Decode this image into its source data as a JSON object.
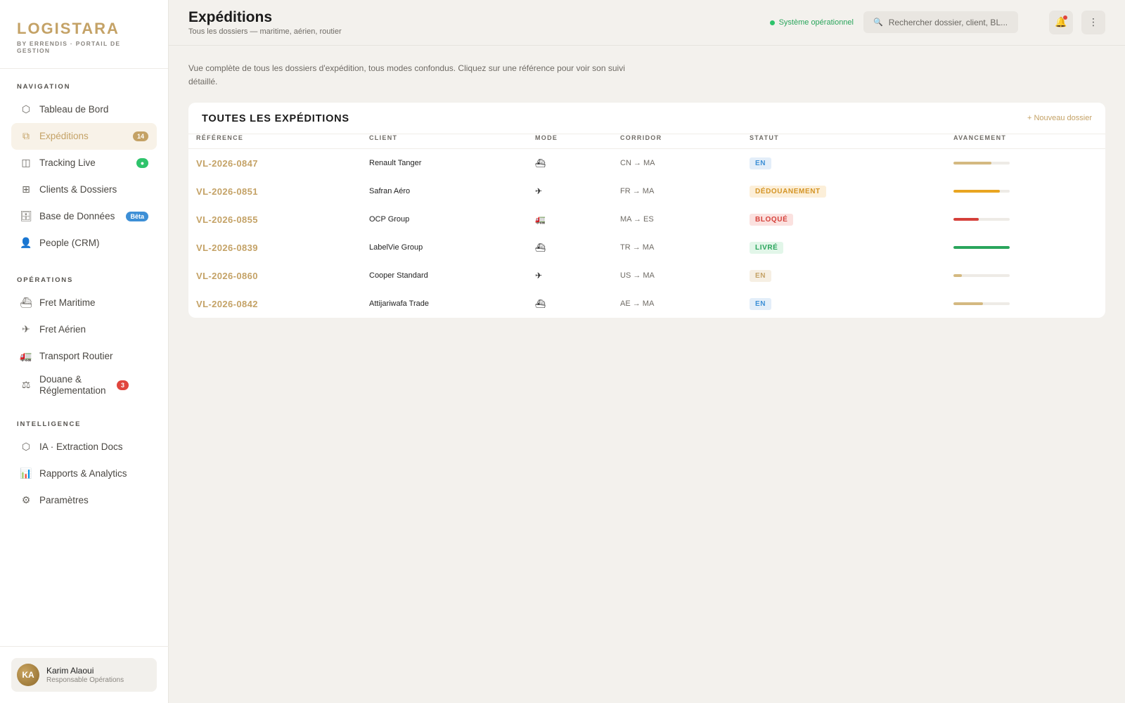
{
  "brand": {
    "name": "LOGISTARA",
    "subtitle": "BY ERRENDIS · PORTAIL DE GESTION"
  },
  "nav": {
    "sections": [
      {
        "title": "NAVIGATION",
        "items": [
          {
            "label": "Tableau de Bord",
            "icon": "hexagon-icon",
            "glyph": "⬡"
          },
          {
            "label": "Expéditions",
            "icon": "layers-icon",
            "glyph": "⧉",
            "badge": "14",
            "active": true
          },
          {
            "label": "Tracking Live",
            "icon": "map-icon",
            "glyph": "◫",
            "badge": "●"
          },
          {
            "label": "Clients & Dossiers",
            "icon": "grid-icon",
            "glyph": "⊞"
          },
          {
            "label": "Base de Données",
            "icon": "database-icon",
            "glyph": "🗄",
            "badge": "Bêta"
          },
          {
            "label": "People (CRM)",
            "icon": "person-icon",
            "glyph": "👤"
          }
        ]
      },
      {
        "title": "OPÉRATIONS",
        "items": [
          {
            "label": "Fret Maritime",
            "icon": "ship-icon",
            "glyph": "⛴"
          },
          {
            "label": "Fret Aérien",
            "icon": "plane-icon",
            "glyph": "✈"
          },
          {
            "label": "Transport Routier",
            "icon": "truck-icon",
            "glyph": "🚛"
          },
          {
            "label": "Douane & Réglementation",
            "icon": "scales-icon",
            "glyph": "⚖",
            "badge": "3"
          }
        ]
      },
      {
        "title": "INTELLIGENCE",
        "items": [
          {
            "label": "IA · Extraction Docs",
            "icon": "hexagon-icon",
            "glyph": "⬡"
          },
          {
            "label": "Rapports & Analytics",
            "icon": "bar-chart-icon",
            "glyph": "📊"
          },
          {
            "label": "Paramètres",
            "icon": "gear-icon",
            "glyph": "⚙"
          }
        ]
      }
    ]
  },
  "user": {
    "initials": "KA",
    "name": "Karim Alaoui",
    "role": "Responsable Opérations"
  },
  "header": {
    "title": "Expéditions",
    "subtitle": "Tous les dossiers — maritime, aérien, routier",
    "status": "Système opérationnel",
    "search_placeholder": "Rechercher dossier, client, BL...",
    "search_icon": "🔍",
    "bell_icon": "🔔",
    "more_icon": "⋮"
  },
  "intro": "Vue complète de tous les dossiers d'expédition, tous modes confondus. Cliquez sur une référence pour voir son suivi détaillé.",
  "table": {
    "title": "TOUTES LES EXPÉDITIONS",
    "new_button": "+ Nouveau dossier",
    "columns": [
      "RÉFÉRENCE",
      "CLIENT",
      "MODE",
      "CORRIDOR",
      "STATUT",
      "AVANCEMENT"
    ],
    "rows": [
      {
        "ref": "VL-2026-0847",
        "client": "Renault Tanger",
        "mode": "⛴",
        "mode_icon": "ship-icon",
        "corridor": "CN → MA",
        "status": "EN",
        "status_color": "blue",
        "progress": 0.68,
        "progress_color": "#d4b981"
      },
      {
        "ref": "VL-2026-0851",
        "client": "Safran Aéro",
        "mode": "✈",
        "mode_icon": "plane-icon",
        "corridor": "FR → MA",
        "status": "DÉDOUANEMENT",
        "status_color": "orange",
        "progress": 0.83,
        "progress_color": "#e9a521"
      },
      {
        "ref": "VL-2026-0855",
        "client": "OCP Group",
        "mode": "🚛",
        "mode_icon": "truck-icon",
        "corridor": "MA → ES",
        "status": "BLOQUÉ",
        "status_color": "red",
        "progress": 0.45,
        "progress_color": "#d5403a"
      },
      {
        "ref": "VL-2026-0839",
        "client": "LabelVie Group",
        "mode": "⛴",
        "mode_icon": "ship-icon",
        "corridor": "TR → MA",
        "status": "LIVRÉ",
        "status_color": "green",
        "progress": 1.0,
        "progress_color": "#2aa55c"
      },
      {
        "ref": "VL-2026-0860",
        "client": "Cooper Standard",
        "mode": "✈",
        "mode_icon": "plane-icon",
        "corridor": "US → MA",
        "status": "EN",
        "status_color": "gold",
        "progress": 0.15,
        "progress_color": "#d4b981"
      },
      {
        "ref": "VL-2026-0842",
        "client": "Attijariwafa Trade",
        "mode": "⛴",
        "mode_icon": "ship-icon",
        "corridor": "AE → MA",
        "status": "EN",
        "status_color": "blue",
        "progress": 0.53,
        "progress_color": "#d4b981"
      }
    ]
  }
}
